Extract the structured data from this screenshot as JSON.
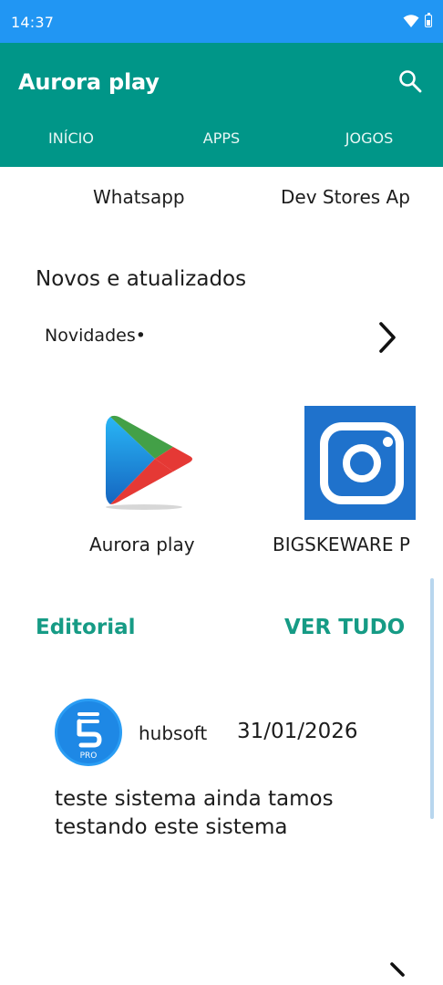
{
  "status_bar": {
    "time": "14:37",
    "wifi_icon": "wifi-icon",
    "battery_icon": "battery-icon"
  },
  "app_bar": {
    "title": "Aurora play",
    "search_icon": "search-icon",
    "tabs": [
      {
        "label": "INÍCIO"
      },
      {
        "label": "APPS"
      },
      {
        "label": "JOGOS"
      }
    ],
    "background": "#009688"
  },
  "prev_row": {
    "apps": [
      "Whatsapp",
      "Dev Stores Ap"
    ]
  },
  "new_section": {
    "title": "Novos e atualizados",
    "subheader": "Novidades•",
    "apps": [
      {
        "name": "Aurora play",
        "icon": "google-play-logo-icon"
      },
      {
        "name": "BIGSKEWARE P",
        "icon": "instagram-logo-icon"
      }
    ]
  },
  "editorial": {
    "title": "Editorial",
    "see_all": "VER TUDO",
    "accent": "#169b85",
    "post": {
      "avatar_text": "PRO",
      "author": "hubsoft",
      "date": "31/01/2026",
      "body": "teste sistema ainda tamos testando este sistema"
    }
  }
}
